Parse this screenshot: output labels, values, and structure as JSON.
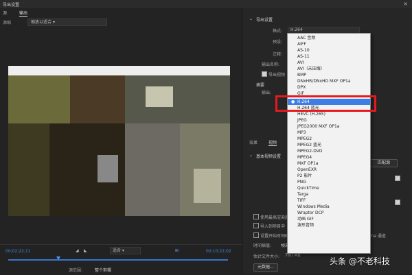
{
  "window": {
    "title": "导出设置"
  },
  "left_panel": {
    "tabs": [
      "源",
      "输出"
    ],
    "source_label": "源缩",
    "source_scaling": "缩放以适合"
  },
  "timeline": {
    "timecode_in": "00;02;22;11",
    "timecode_out": "00;10;22;02",
    "fit_value": "适合",
    "source_range_label": "源范围:",
    "source_range_value": "整个剪辑"
  },
  "right_panel": {
    "export_settings_header": "导出设置",
    "format_label": "格式:",
    "format_value": "H.264",
    "preset_label": "预设:",
    "comment_label": "注释:",
    "output_name_label": "输出名称:",
    "export_video_label": "导出视频",
    "summary_header": "摘要",
    "output_label": "输出:",
    "tab_effects": "效果",
    "tab_video": "视频",
    "basic_video_header": "基本视频设置",
    "match_source_button": "匹配源",
    "use_max_render": "使用最高渲染质量",
    "import_into_project": "导入到项目中",
    "set_start_timecode": "设置开始时间码",
    "render_alpha": "仅渲染 Alpha 通道",
    "time_interpolation_label": "时间插值:",
    "time_interpolation_value": "帧采样",
    "estimated_size_label": "估计文件大小:",
    "estimated_size_value": "760 MB",
    "metadata_button": "元数据..."
  },
  "format_dropdown": {
    "items": [
      "AAC 音频",
      "AIFF",
      "AS-10",
      "AS-11",
      "AVI",
      "AVI（未压缩）",
      "BMP",
      "DNxHR/DNxHD MXF OP1a",
      "DPX",
      "GIF",
      "H.264",
      "H.264 蓝光",
      "HEVC (H.265)",
      "JPEG",
      "JPEG2000 MXF OP1a",
      "MP3",
      "MPEG2",
      "MPEG2 蓝光",
      "MPEG2-DVD",
      "MPEG4",
      "MXF OP1a",
      "OpenEXR",
      "P2 影片",
      "PNG",
      "QuickTime",
      "Targa",
      "TIFF",
      "Windows Media",
      "Wraptor DCP",
      "动画 GIF",
      "波形音频"
    ],
    "selected": "H.264"
  },
  "watermark": "头条 @不老科技",
  "colors": {
    "accent": "#3d7ee6",
    "highlight_border": "#e6191e",
    "timecode": "#3b8be0"
  }
}
